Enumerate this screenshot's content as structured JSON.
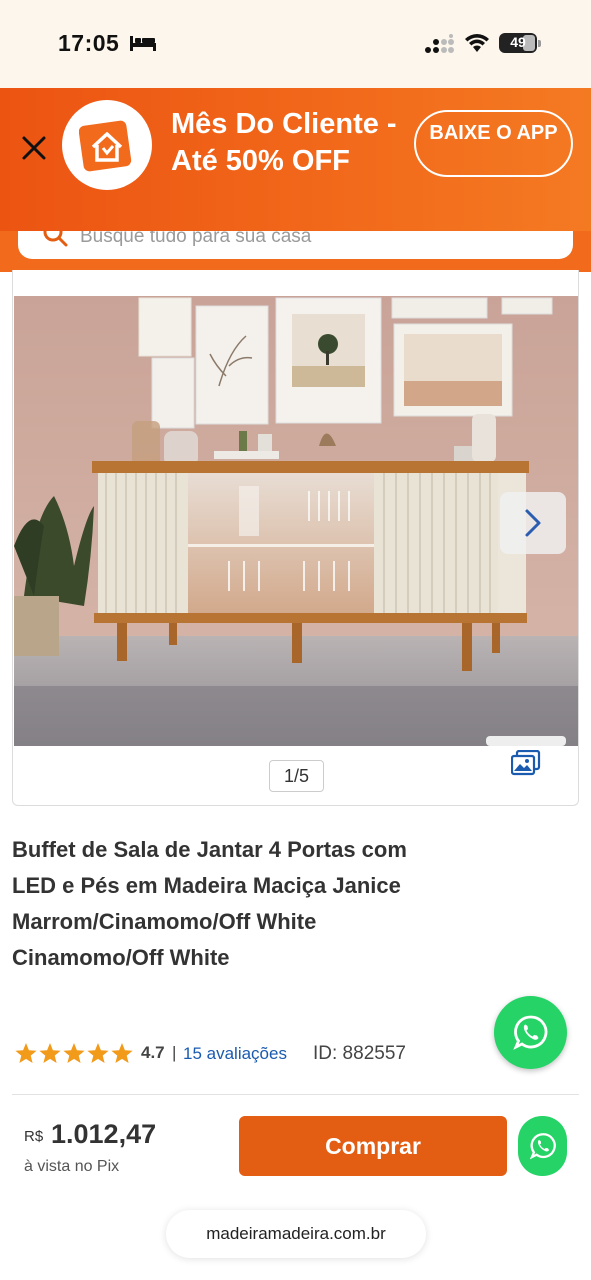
{
  "status_bar": {
    "time": "17:05",
    "battery": "49",
    "icons": [
      "bed-icon",
      "signal-icon",
      "wifi-icon",
      "battery-icon"
    ]
  },
  "banner": {
    "promo_text": "Mês Do Cliente - Até 50% OFF",
    "download_button": "BAIXE O APP",
    "close_icon": "close-icon",
    "logo_icon": "app-logo-house-icon",
    "colors": {
      "background": "#f26a1b",
      "text": "#ffffff"
    }
  },
  "search": {
    "placeholder": "Busque tudo para sua casa"
  },
  "gallery": {
    "counter": "1/5",
    "next_icon": "chevron-right-icon",
    "gallery_icon": "image-gallery-icon"
  },
  "product": {
    "title": "Buffet de Sala de Jantar 4 Portas com LED e Pés em Madeira Maciça Janice Marrom/Cinamomo/Off White Cinamomo/Off White",
    "rating": "4.7",
    "stars": 5,
    "separator": "|",
    "reviews": "15 avaliações",
    "id": "ID: 882557"
  },
  "purchase": {
    "currency": "R$",
    "price": "1.012,47",
    "payment_note": "à vista no Pix",
    "buy_button": "Comprar",
    "accent_color": "#e35d12",
    "whatsapp_color": "#25d366"
  },
  "browser": {
    "url": "madeiramadeira.com.br"
  }
}
